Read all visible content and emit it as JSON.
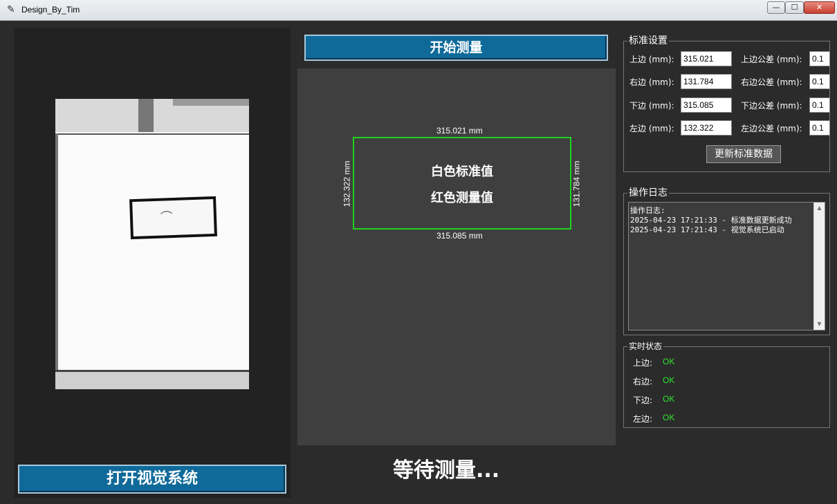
{
  "window": {
    "title": "Design_By_Tim",
    "min": "—",
    "max": "☐",
    "close": "✕"
  },
  "left": {
    "open_button": "打开视觉系统"
  },
  "center": {
    "start_button": "开始测量",
    "dims": {
      "top": "315.021 mm",
      "bottom": "315.085 mm",
      "left": "132.322 mm",
      "right": "131.784 mm"
    },
    "legend_white": "白色标准值",
    "legend_red": "红色测量值",
    "waiting": "等待测量..."
  },
  "standard": {
    "title": "标准设置",
    "fields": [
      {
        "label": "上边 (mm):",
        "value": "315.021",
        "tol_label": "上边公差 (mm):",
        "tol": "0.1"
      },
      {
        "label": "右边 (mm):",
        "value": "131.784",
        "tol_label": "右边公差 (mm):",
        "tol": "0.1"
      },
      {
        "label": "下边 (mm):",
        "value": "315.085",
        "tol_label": "下边公差 (mm):",
        "tol": "0.1"
      },
      {
        "label": "左边 (mm):",
        "value": "132.322",
        "tol_label": "左边公差 (mm):",
        "tol": "0.1"
      }
    ],
    "update_button": "更新标准数据"
  },
  "log": {
    "title": "操作日志",
    "lines": [
      "操作日志:",
      "2025-04-23 17:21:33 - 标准数据更新成功",
      "2025-04-23 17:21:43 - 视觉系统已启动"
    ]
  },
  "status": {
    "title": "实时状态",
    "items": [
      {
        "label": "上边:",
        "value": "OK"
      },
      {
        "label": "右边:",
        "value": "OK"
      },
      {
        "label": "下边:",
        "value": "OK"
      },
      {
        "label": "左边:",
        "value": "OK"
      }
    ]
  },
  "colors": {
    "accent_button": "#0f6a9a",
    "ok": "#2ee62e",
    "measure_rect": "#1ed21e"
  }
}
